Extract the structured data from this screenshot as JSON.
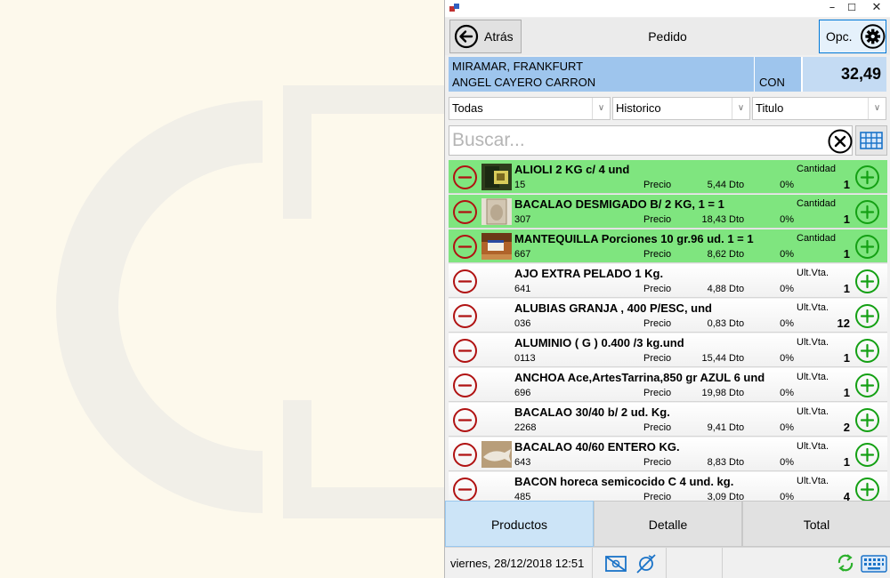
{
  "window": {
    "minimize": "–",
    "maximize": "☐",
    "close": "✕"
  },
  "header": {
    "back_label": "Atrás",
    "title": "Pedido",
    "options_label": "Opc."
  },
  "customer": {
    "line1": "MIRAMAR, FRANKFURT",
    "line2": "ANGEL CAYERO CARRON",
    "type": "CON",
    "total": "32,49"
  },
  "filters": {
    "family": "Todas",
    "mode": "Historico",
    "sort": "Titulo"
  },
  "search": {
    "placeholder": "Buscar..."
  },
  "colors": {
    "selected_row": "#7fe57f",
    "minus": "#b01212",
    "plus": "#14a014",
    "accent": "#0078d7"
  },
  "products": [
    {
      "name": "ALIOLI 2 KG c/ 4 und",
      "code": "15",
      "price_label": "Precio",
      "price": "5,44",
      "disc_label": "Dto",
      "discount": "0%",
      "qty_label": "Cantidad",
      "qty": "1",
      "selected": true,
      "thumb": "alioli-image"
    },
    {
      "name": "BACALAO DESMIGADO B/ 2  KG, 1 = 1",
      "code": "307",
      "price_label": "Precio",
      "price": "18,43",
      "disc_label": "Dto",
      "discount": "0%",
      "qty_label": "Cantidad",
      "qty": "1",
      "selected": true,
      "thumb": "bacalao-desmigado-image"
    },
    {
      "name": "MANTEQUILLA Porciones 10 gr.96 ud. 1 = 1",
      "code": "667",
      "price_label": "Precio",
      "price": "8,62",
      "disc_label": "Dto",
      "discount": "0%",
      "qty_label": "Cantidad",
      "qty": "1",
      "selected": true,
      "thumb": "mantequilla-image"
    },
    {
      "name": "AJO EXTRA PELADO 1 Kg.",
      "code": "641",
      "price_label": "Precio",
      "price": "4,88",
      "disc_label": "Dto",
      "discount": "0%",
      "qty_label": "Ult.Vta.",
      "qty": "1",
      "selected": false,
      "thumb": ""
    },
    {
      "name": "ALUBIAS GRANJA , 400 P/ESC, und",
      "code": "036",
      "price_label": "Precio",
      "price": "0,83",
      "disc_label": "Dto",
      "discount": "0%",
      "qty_label": "Ult.Vta.",
      "qty": "12",
      "selected": false,
      "thumb": ""
    },
    {
      "name": "ALUMINIO ( G ) 0.400 /3 kg.und",
      "code": "0113",
      "price_label": "Precio",
      "price": "15,44",
      "disc_label": "Dto",
      "discount": "0%",
      "qty_label": "Ult.Vta.",
      "qty": "1",
      "selected": false,
      "thumb": ""
    },
    {
      "name": "ANCHOA Ace,ArtesTarrina,850 gr AZUL 6 und",
      "code": "696",
      "price_label": "Precio",
      "price": "19,98",
      "disc_label": "Dto",
      "discount": "0%",
      "qty_label": "Ult.Vta.",
      "qty": "1",
      "selected": false,
      "thumb": ""
    },
    {
      "name": "BACALAO 30/40 b/ 2 ud. Kg.",
      "code": "2268",
      "price_label": "Precio",
      "price": "9,41",
      "disc_label": "Dto",
      "discount": "0%",
      "qty_label": "Ult.Vta.",
      "qty": "2",
      "selected": false,
      "thumb": ""
    },
    {
      "name": "BACALAO 40/60 ENTERO KG.",
      "code": "643",
      "price_label": "Precio",
      "price": "8,83",
      "disc_label": "Dto",
      "discount": "0%",
      "qty_label": "Ult.Vta.",
      "qty": "1",
      "selected": false,
      "thumb": "bacalao-entero-image"
    },
    {
      "name": "BACON horeca semicocido  C 4 und. kg.",
      "code": "485",
      "price_label": "Precio",
      "price": "3,09",
      "disc_label": "Dto",
      "discount": "0%",
      "qty_label": "Ult.Vta.",
      "qty": "4",
      "selected": false,
      "thumb": ""
    }
  ],
  "tabs": [
    {
      "label": "Productos",
      "active": true
    },
    {
      "label": "Detalle",
      "active": false
    },
    {
      "label": "Total",
      "active": false
    }
  ],
  "status": {
    "date": "viernes, 28/12/2018 12:51"
  }
}
